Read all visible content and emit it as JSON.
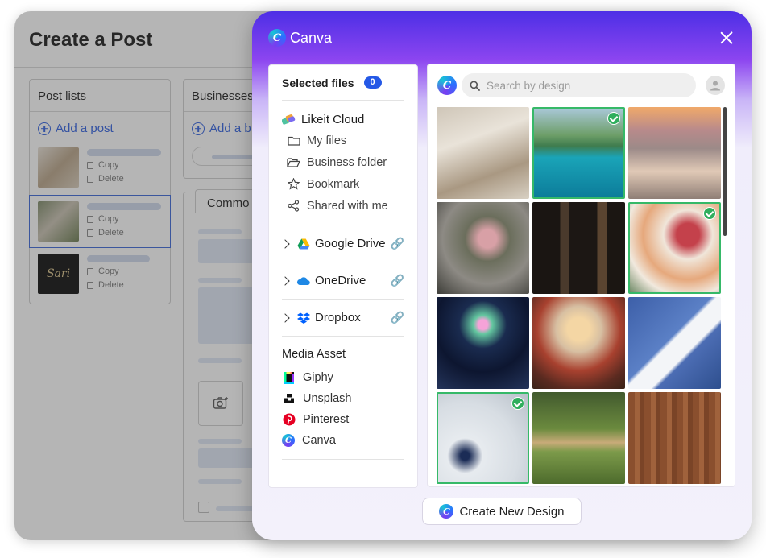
{
  "background": {
    "title": "Create a Post",
    "post_lists": {
      "title": "Post lists",
      "add_label": "Add a post",
      "posts": [
        {
          "copy": "Copy",
          "delete": "Delete",
          "thumb_text": ""
        },
        {
          "copy": "Copy",
          "delete": "Delete",
          "thumb_text": ""
        },
        {
          "copy": "Copy",
          "delete": "Delete",
          "thumb_text": "Sari"
        }
      ]
    },
    "businesses": {
      "title": "Businesses",
      "add_label": "Add a b"
    },
    "common_tab": "Commo"
  },
  "modal": {
    "title": "Canva",
    "selected_files": {
      "label": "Selected files",
      "count": "0"
    },
    "likeit": {
      "title": "Likeit Cloud",
      "items": [
        "My files",
        "Business folder",
        "Bookmark",
        "Shared with me"
      ]
    },
    "clouds": [
      "Google Drive",
      "OneDrive",
      "Dropbox"
    ],
    "media_asset": {
      "title": "Media Asset",
      "items": [
        "Giphy",
        "Unsplash",
        "Pinterest",
        "Canva"
      ]
    },
    "search": {
      "placeholder": "Search by design"
    },
    "create_button": "Create New Design",
    "images_checked": [
      false,
      true,
      false,
      false,
      false,
      true,
      false,
      false,
      false,
      true,
      false,
      false
    ]
  },
  "colors": {
    "accent": "#2458e6",
    "check": "#2fae5d",
    "header_start": "#4d2fe6",
    "header_end": "#8c45f0"
  }
}
